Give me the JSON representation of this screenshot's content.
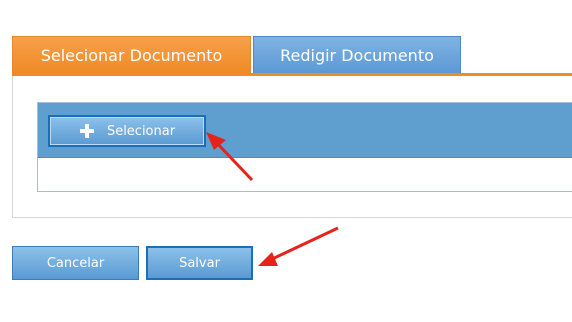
{
  "tabs": [
    {
      "label": "Selecionar Documento",
      "active": true
    },
    {
      "label": "Redigir Documento",
      "active": false
    }
  ],
  "upload": {
    "select_label": "Selecionar",
    "select_icon": "plus-icon"
  },
  "actions": {
    "cancel_label": "Cancelar",
    "save_label": "Salvar"
  },
  "colors": {
    "active_tab": "#ef8a24",
    "inactive_tab": "#5b98d4",
    "toolbar": "#5f9fcf",
    "annotation_arrow": "#e5231b"
  }
}
